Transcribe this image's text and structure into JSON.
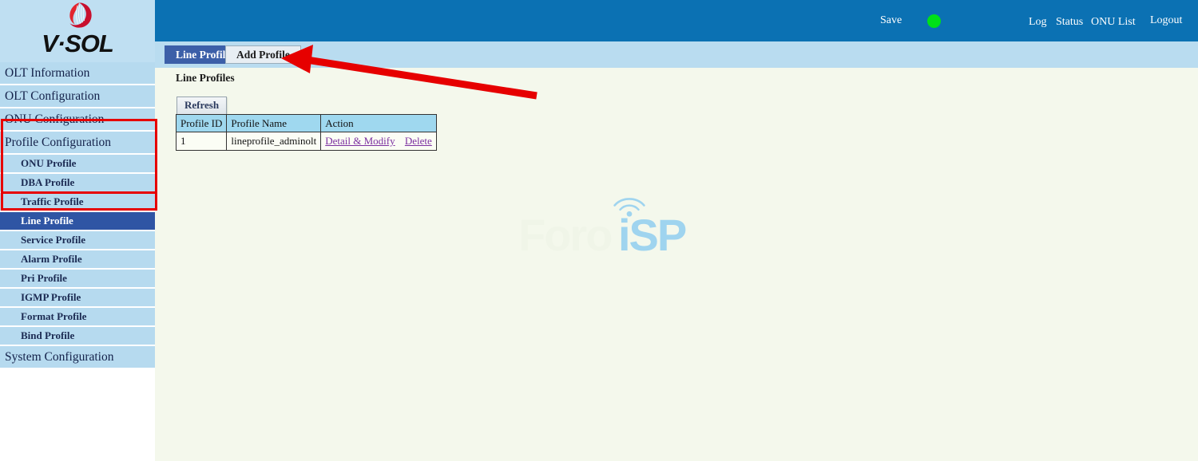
{
  "brand": {
    "logo_text": "V·SOL",
    "logo_icon": "vsol-sphere-icon"
  },
  "header": {
    "save_label": "Save",
    "status_led_color": "#00e118",
    "links": [
      {
        "label": "Log"
      },
      {
        "label": "Status"
      },
      {
        "label": "ONU List"
      },
      {
        "label": "Logout"
      }
    ],
    "log_label": "Log",
    "status_label": "Status",
    "onu_list_label": "ONU List",
    "logout_label": "Logout",
    "background": "#0b71b3"
  },
  "sidebar": {
    "background": "#b6daef",
    "active_background": "#2f55a4",
    "items": [
      {
        "label": "OLT Information",
        "level": "top",
        "active": false
      },
      {
        "label": "OLT Configuration",
        "level": "top",
        "active": false
      },
      {
        "label": "ONU Configuration",
        "level": "top",
        "active": false
      },
      {
        "label": "Profile Configuration",
        "level": "top",
        "active": false
      },
      {
        "label": "ONU Profile",
        "level": "sub",
        "active": false
      },
      {
        "label": "DBA Profile",
        "level": "sub",
        "active": false
      },
      {
        "label": "Traffic Profile",
        "level": "sub",
        "active": false
      },
      {
        "label": "Line Profile",
        "level": "sub",
        "active": true
      },
      {
        "label": "Service Profile",
        "level": "sub",
        "active": false
      },
      {
        "label": "Alarm Profile",
        "level": "sub",
        "active": false
      },
      {
        "label": "Pri Profile",
        "level": "sub",
        "active": false
      },
      {
        "label": "IGMP Profile",
        "level": "sub",
        "active": false
      },
      {
        "label": "Format Profile",
        "level": "sub",
        "active": false
      },
      {
        "label": "Bind Profile",
        "level": "sub",
        "active": false
      },
      {
        "label": "System Configuration",
        "level": "top",
        "active": false
      }
    ]
  },
  "tabs": [
    {
      "label": "Line Profile",
      "active": true
    },
    {
      "label": "Add Profile",
      "active": false
    }
  ],
  "tab_line_label": "Line Profile",
  "tab_add_label": "Add Profile",
  "main": {
    "page_title": "Line Profiles",
    "refresh_label": "Refresh",
    "table": {
      "headers": [
        "Profile ID",
        "Profile Name",
        "Action"
      ],
      "header_id": "Profile ID",
      "header_name": "Profile Name",
      "header_action": "Action",
      "rows": [
        {
          "profile_id": "1",
          "profile_name": "lineprofile_adminolt",
          "actions": [
            "Detail & Modify",
            "Delete"
          ],
          "action_detail": "Detail & Modify",
          "action_delete": "Delete"
        }
      ]
    }
  },
  "watermark": {
    "text_left": "Foro",
    "text_right": "iSP",
    "color_left": "#f0f5e8",
    "color_right": "#9fd4ef"
  },
  "annotations": {
    "arrow_color": "#e60000",
    "arrow_target": "Add Profile tab",
    "highlight_color": "#e60000",
    "highlighted_group": "Profile Configuration",
    "highlighted_item": "Line Profile"
  }
}
